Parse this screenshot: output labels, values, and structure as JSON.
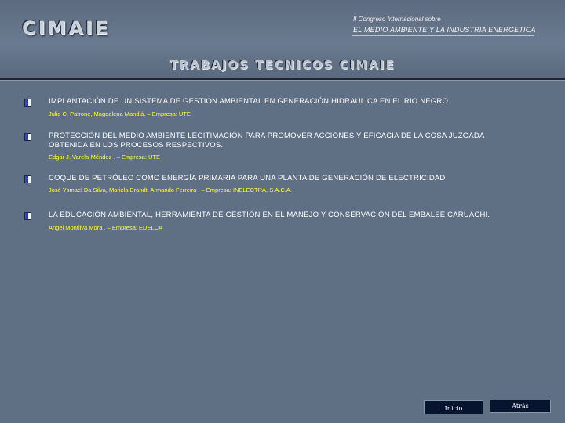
{
  "header": {
    "logo": "CIMAIE",
    "congress_subtitle": "II Congreso Internacional sobre",
    "congress_title": "EL MEDIO AMBIENTE Y LA INDUSTRIA ENERGETICA",
    "section_title": "TRABAJOS TECNICOS CIMAIE"
  },
  "papers": [
    {
      "title": "IMPLANTACIÓN DE UN SISTEMA DE GESTION AMBIENTAL EN GENERACIÓN HIDRAULICA EN EL RIO NEGRO",
      "authors": "Julio C. Patrone, Magdalena Mandiá. – Empresa:  UTE"
    },
    {
      "title": "PROTECCIÓN DEL MEDIO AMBIENTE LEGITIMACIÓN PARA PROMOVER ACCIONES Y EFICACIA DE LA COSA JUZGADA OBTENIDA EN LOS PROCESOS RESPECTIVOS.",
      "authors": "Edgar J. Varela-Méndez . – Empresa:  UTE"
    },
    {
      "title": "COQUE DE PETRÓLEO COMO ENERGÍA PRIMARIA PARA UNA PLANTA DE GENERACIÓN DE ELECTRICIDAD",
      "authors": "José Ysmael Da Silva, Mariela Brandt, Armando Ferreira . – Empresa:  INELECTRA, S.A.C.A."
    },
    {
      "title": "LA EDUCACIÓN AMBIENTAL, HERRAMIENTA DE GESTIÓN EN EL MANEJO Y CONSERVACIÓN DEL EMBALSE CARUACHI.",
      "authors": "Angel Montilva Mora . – Empresa:  EDELCA"
    }
  ],
  "nav": {
    "home_label": "Inicio",
    "back_label": "Atrás"
  },
  "colors": {
    "background": "#5f6f84",
    "authors": "#ffff33",
    "button_bg": "#07142f"
  }
}
